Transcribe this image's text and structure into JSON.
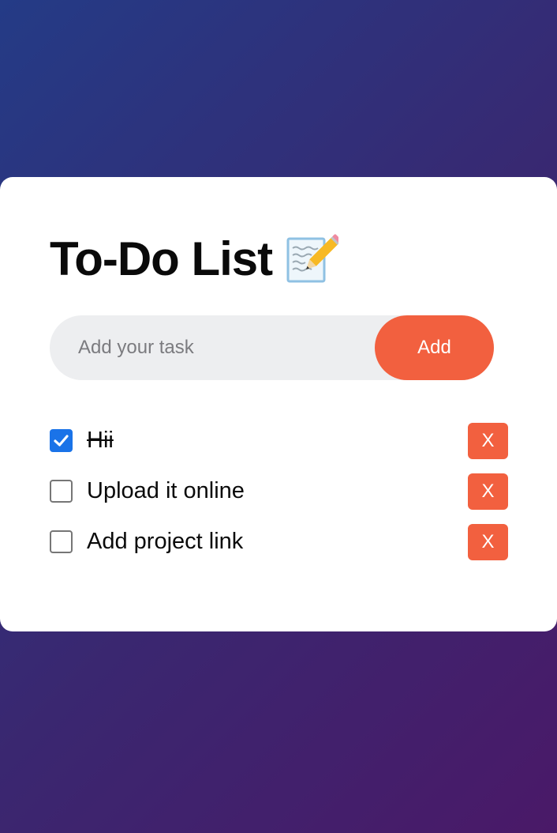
{
  "app": {
    "title": "To-Do List",
    "title_icon": "memo-pencil-icon"
  },
  "input": {
    "placeholder": "Add your task",
    "value": "",
    "add_label": "Add"
  },
  "tasks": [
    {
      "label": "Hii",
      "done": true,
      "delete_label": "X"
    },
    {
      "label": "Upload it online",
      "done": false,
      "delete_label": "X"
    },
    {
      "label": "Add project link",
      "done": false,
      "delete_label": "X"
    }
  ],
  "colors": {
    "accent": "#f2603f",
    "check": "#1a73e8",
    "bg_start": "#243b86",
    "bg_end": "#4a1968"
  }
}
